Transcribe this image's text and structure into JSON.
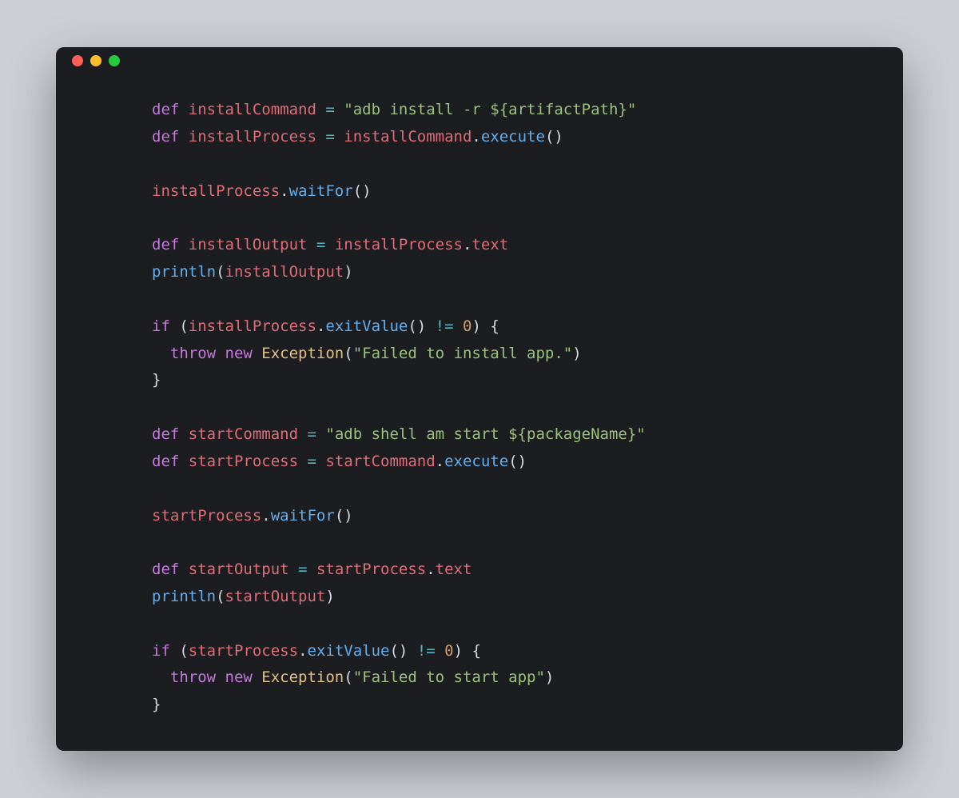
{
  "dots": {
    "red": "#ff5f56",
    "yellow": "#ffbd2e",
    "green": "#27c93f"
  },
  "c": {
    "l1_def": "def ",
    "l1_id": "installCommand ",
    "l1_eq": "= ",
    "l1_str": "\"adb install -r ${artifactPath}\"",
    "l2_def": "def ",
    "l2_id": "installProcess ",
    "l2_eq": "= ",
    "l2_id2": "installCommand",
    "l2_dot": ".",
    "l2_fn": "execute",
    "l2_p": "()",
    "l4_id": "installProcess",
    "l4_dot": ".",
    "l4_fn": "waitFor",
    "l4_p": "()",
    "l6_def": "def ",
    "l6_id": "installOutput ",
    "l6_eq": "= ",
    "l6_id2": "installProcess",
    "l6_dot": ".",
    "l6_id3": "text",
    "l7_fn": "println",
    "l7_p1": "(",
    "l7_id": "installOutput",
    "l7_p2": ")",
    "l9_if": "if ",
    "l9_p1": "(",
    "l9_id": "installProcess",
    "l9_dot": ".",
    "l9_fn": "exitValue",
    "l9_p2": "() ",
    "l9_ne": "!= ",
    "l9_num": "0",
    "l9_p3": ") {",
    "l10_th": "  throw ",
    "l10_new": "new ",
    "l10_cls": "Exception",
    "l10_p1": "(",
    "l10_str": "\"Failed to install app.\"",
    "l10_p2": ")",
    "l11": "}",
    "l13_def": "def ",
    "l13_id": "startCommand ",
    "l13_eq": "= ",
    "l13_str": "\"adb shell am start ${packageName}\"",
    "l14_def": "def ",
    "l14_id": "startProcess ",
    "l14_eq": "= ",
    "l14_id2": "startCommand",
    "l14_dot": ".",
    "l14_fn": "execute",
    "l14_p": "()",
    "l16_id": "startProcess",
    "l16_dot": ".",
    "l16_fn": "waitFor",
    "l16_p": "()",
    "l18_def": "def ",
    "l18_id": "startOutput ",
    "l18_eq": "= ",
    "l18_id2": "startProcess",
    "l18_dot": ".",
    "l18_id3": "text",
    "l19_fn": "println",
    "l19_p1": "(",
    "l19_id": "startOutput",
    "l19_p2": ")",
    "l21_if": "if ",
    "l21_p1": "(",
    "l21_id": "startProcess",
    "l21_dot": ".",
    "l21_fn": "exitValue",
    "l21_p2": "() ",
    "l21_ne": "!= ",
    "l21_num": "0",
    "l21_p3": ") {",
    "l22_th": "  throw ",
    "l22_new": "new ",
    "l22_cls": "Exception",
    "l22_p1": "(",
    "l22_str": "\"Failed to start app\"",
    "l22_p2": ")",
    "l23": "}"
  }
}
